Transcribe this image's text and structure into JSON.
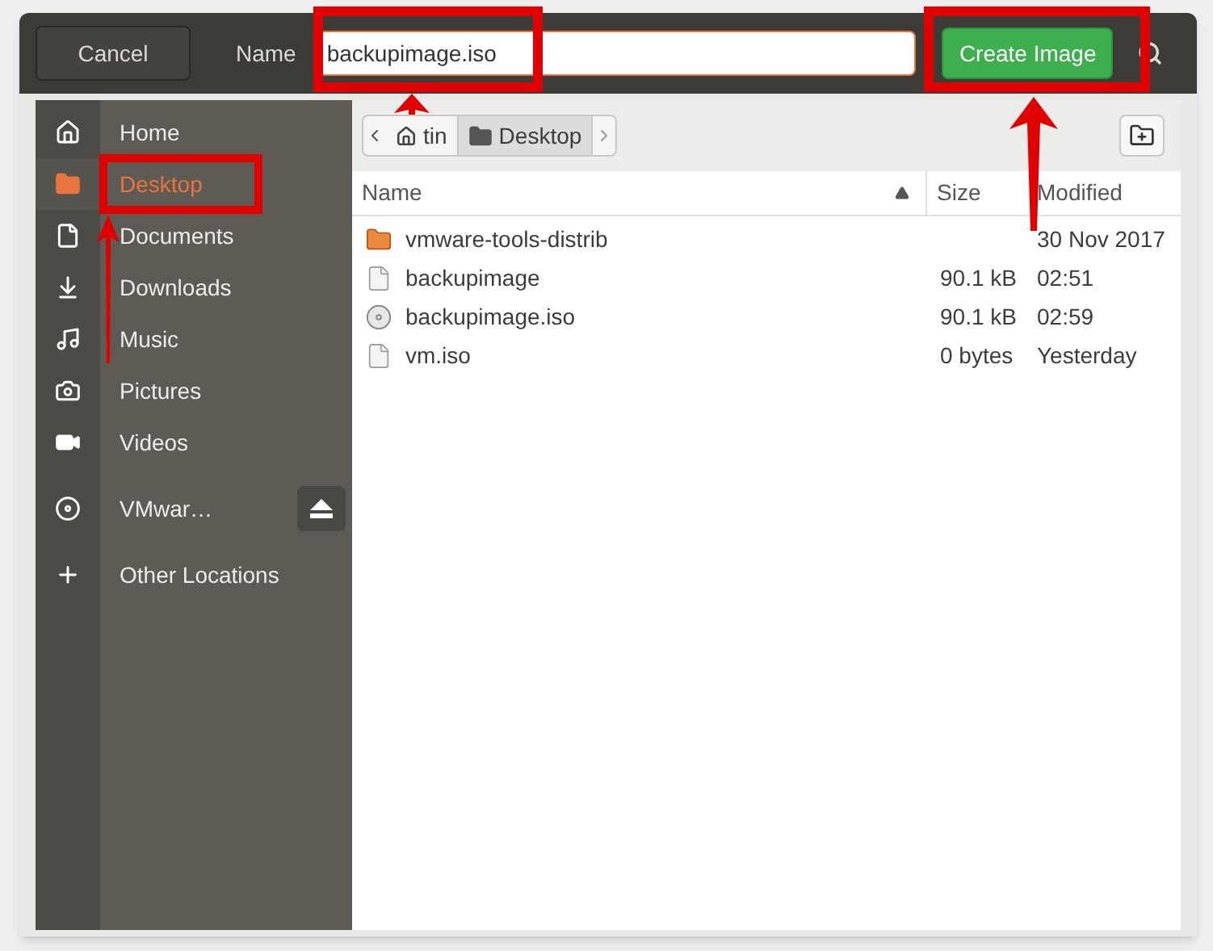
{
  "header": {
    "cancel": "Cancel",
    "name_label": "Name",
    "name_value": "backupimage.iso",
    "create": "Create Image"
  },
  "sidebar": {
    "sections": [
      [
        {
          "kind": "home",
          "label": "Home",
          "selected": false
        },
        {
          "kind": "folder",
          "label": "Desktop",
          "selected": true
        },
        {
          "kind": "document",
          "label": "Documents",
          "selected": false
        },
        {
          "kind": "download",
          "label": "Downloads",
          "selected": false
        },
        {
          "kind": "music",
          "label": "Music",
          "selected": false
        },
        {
          "kind": "camera",
          "label": "Pictures",
          "selected": false
        },
        {
          "kind": "video",
          "label": "Videos",
          "selected": false
        }
      ],
      [
        {
          "kind": "disc",
          "label": "VMwar…",
          "selected": false,
          "ejectable": true
        }
      ],
      [
        {
          "kind": "plus",
          "label": "Other Locations",
          "selected": false
        }
      ]
    ]
  },
  "path_bar": {
    "crumbs": [
      {
        "kind": "home",
        "label": "tin",
        "selected": false
      },
      {
        "kind": "folder",
        "label": "Desktop",
        "selected": true
      }
    ]
  },
  "table": {
    "columns": [
      {
        "label": "Name",
        "sorted": true
      },
      {
        "label": "Size",
        "sorted": false
      },
      {
        "label": "Modified",
        "sorted": false
      }
    ],
    "rows": [
      {
        "kind": "folder",
        "name": "vmware-tools-distrib",
        "modified": "30 Nov 2017"
      },
      {
        "kind": "file",
        "name": "backupimage",
        "size": "90.1 kB",
        "modified": "02:51"
      },
      {
        "kind": "disc",
        "name": "backupimage.iso",
        "size": "90.1 kB",
        "modified": "02:59"
      },
      {
        "kind": "file",
        "name": "vm.iso",
        "size": "0 bytes",
        "modified": "Yesterday"
      }
    ]
  }
}
